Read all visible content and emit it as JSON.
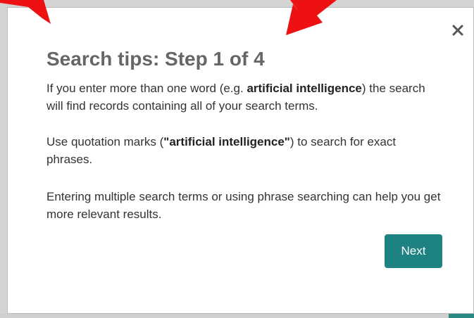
{
  "dialog": {
    "title": "Search tips: Step 1 of 4",
    "close_icon": "close-icon",
    "paragraph_1": {
      "before": "If you enter more than one word (e.g. ",
      "bold": "artificial intelligence",
      "after": ") the search will find records containing all of your search terms."
    },
    "paragraph_2": {
      "before": "Use quotation marks (",
      "bold": "\"artificial intelligence\"",
      "after": ") to search for exact phrases."
    },
    "paragraph_3": "Entering multiple search terms or using phrase searching can help you get more relevant results.",
    "next_label": "Next"
  },
  "colors": {
    "accent": "#1f8282",
    "arrow": "#ee1111",
    "title": "#666666"
  }
}
